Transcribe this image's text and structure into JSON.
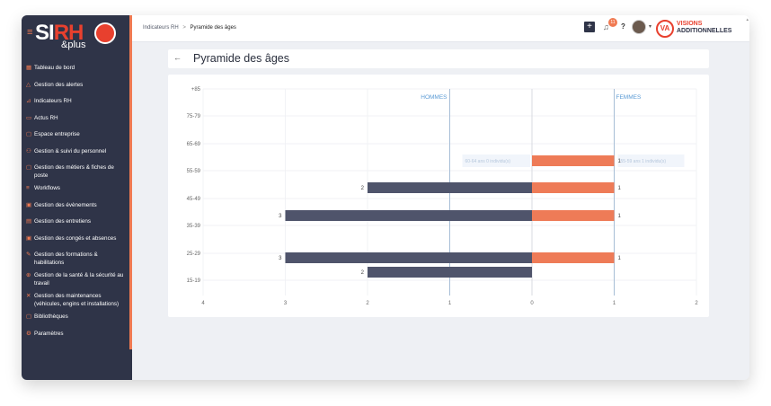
{
  "sidebar": {
    "brand_main": "SI",
    "brand_accent": "RH",
    "brand_sub": "&plus",
    "items": [
      {
        "label": "Tableau de bord",
        "icon": "dashboard-icon",
        "glyph": "▦"
      },
      {
        "label": "Gestion des alertes",
        "icon": "bell-icon",
        "glyph": "△"
      },
      {
        "label": "Indicateurs RH",
        "icon": "chart-icon",
        "glyph": "⊿"
      },
      {
        "label": "Actus RH",
        "icon": "news-icon",
        "glyph": "▭"
      },
      {
        "label": "Espace entreprise",
        "icon": "building-icon",
        "glyph": "▢"
      },
      {
        "label": "Gestion & suivi du personnel",
        "icon": "people-icon",
        "glyph": "⚇"
      },
      {
        "label": "Gestion des métiers & fiches de poste",
        "icon": "folder-icon",
        "glyph": "▢"
      },
      {
        "label": "Workflows",
        "icon": "workflow-icon",
        "glyph": "≡"
      },
      {
        "label": "Gestion des évènements",
        "icon": "calendar-icon",
        "glyph": "▣"
      },
      {
        "label": "Gestion des entretiens",
        "icon": "interview-icon",
        "glyph": "▤"
      },
      {
        "label": "Gestion des congés et absences",
        "icon": "calendar-icon",
        "glyph": "▣"
      },
      {
        "label": "Gestion des formations & habilitations",
        "icon": "training-icon",
        "glyph": "✎"
      },
      {
        "label": "Gestion de la santé & la sécurité au travail",
        "icon": "health-icon",
        "glyph": "⊕"
      },
      {
        "label": "Gestion des maintenances (véhicules, engins et installations)",
        "icon": "tools-icon",
        "glyph": "✕"
      },
      {
        "label": "Bibliothèques",
        "icon": "library-icon",
        "glyph": "▢"
      },
      {
        "label": "Paramètres",
        "icon": "settings-icon",
        "glyph": "⚙"
      }
    ]
  },
  "topbar": {
    "breadcrumb_parent": "Indicateurs RH",
    "breadcrumb_sep": ">",
    "breadcrumb_current": "Pyramide des âges",
    "add_label": "+",
    "notification_count": "11",
    "help_label": "?",
    "brand_line1": "VISIONS",
    "brand_line2": "ADDITIONNELLES",
    "brand_mark": "VA"
  },
  "page": {
    "back_label": "←",
    "title": "Pyramide des âges"
  },
  "colors": {
    "sidebar_bg": "#2f3448",
    "accent": "#f07a52",
    "men_bar": "#4f546b",
    "women_bar": "#ee7b57",
    "group_line": "#9fb9d3",
    "group_label": "#5b9bd5"
  },
  "chart_data": {
    "type": "bar",
    "orientation": "horizontal",
    "categories": [
      "+85",
      "75-79",
      "65-69",
      "55-59",
      "45-49",
      "35-39",
      "25-29",
      "15-19"
    ],
    "groups": [
      "HOMMES",
      "FEMMES"
    ],
    "bars": [
      {
        "series": "HOMMES",
        "y": "55-59",
        "value": 0,
        "label": "0"
      },
      {
        "series": "FEMMES",
        "y": "55-59",
        "value": 1,
        "label": "1"
      },
      {
        "series": "HOMMES",
        "y": "50-54",
        "value": 2,
        "label": "2"
      },
      {
        "series": "FEMMES",
        "y": "50-54",
        "value": 1,
        "label": "1"
      },
      {
        "series": "HOMMES",
        "y": "40-44",
        "value": 3,
        "label": "3"
      },
      {
        "series": "FEMMES",
        "y": "40-44",
        "value": 1,
        "label": "1"
      },
      {
        "series": "HOMMES",
        "y": "25-29",
        "value": 3,
        "label": "3"
      },
      {
        "series": "FEMMES",
        "y": "25-29",
        "value": 1,
        "label": "1"
      },
      {
        "series": "HOMMES",
        "y": "20-24",
        "value": 2,
        "label": "2"
      }
    ],
    "x_ticks": [
      "4",
      "3",
      "2",
      "1",
      "0",
      "1",
      "2"
    ],
    "x_tick_values": [
      -4,
      -3,
      -2,
      -1,
      0,
      1,
      2
    ],
    "xlim": [
      -4,
      2
    ],
    "tooltips": [
      "60-64 ans 0 individu(s)",
      "55-59 ans 1 individu(s)"
    ],
    "grid": true
  }
}
